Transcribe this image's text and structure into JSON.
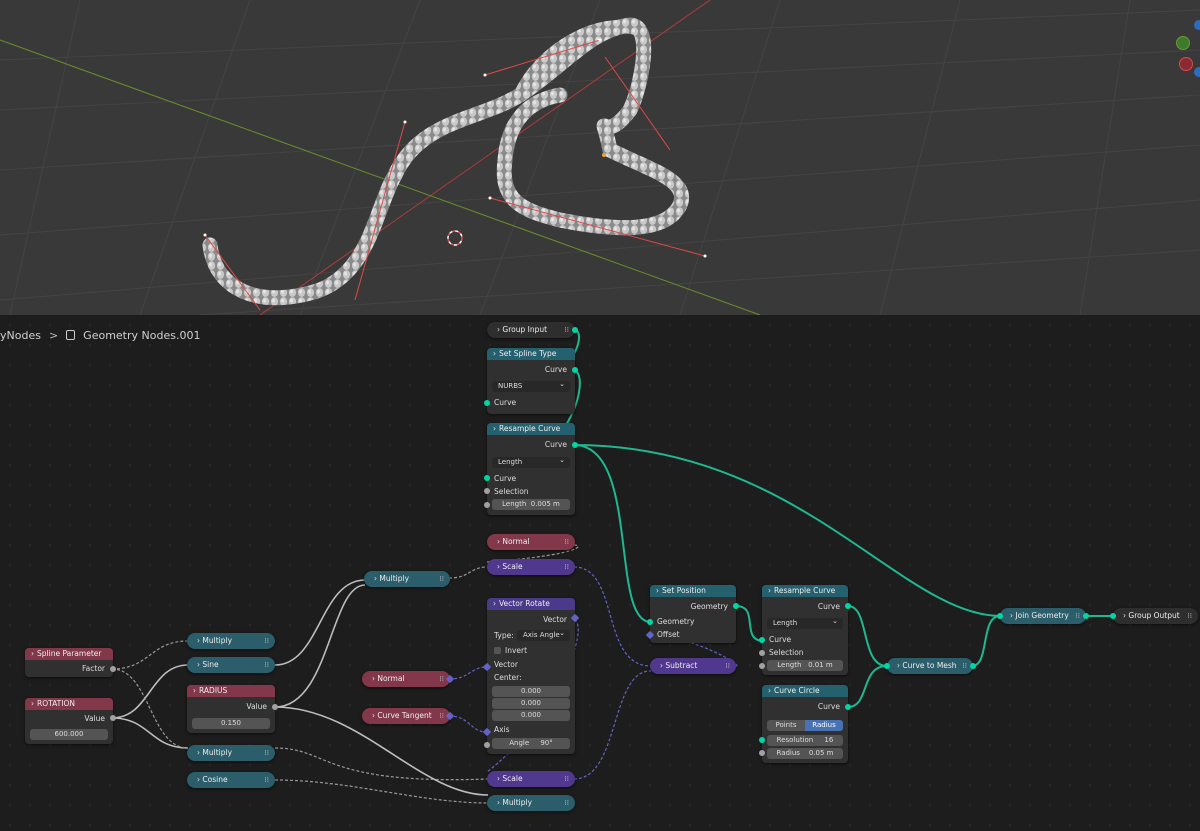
{
  "breadcrumb": {
    "root": "yNodes",
    "separator": ">",
    "tree_name": "Geometry Nodes.001"
  },
  "colors": {
    "geometry_socket": "#00d6a3",
    "value_socket": "#a1a1a1",
    "vector_socket": "#6363c7",
    "input_header": "#82374b",
    "geometry_header": "#25606e",
    "vector_header": "#4a3a8c"
  },
  "nodes": {
    "group_input": {
      "label": "Group Input"
    },
    "set_spline_type": {
      "title": "Set Spline Type",
      "out_curve": "Curve",
      "mode": "NURBS",
      "in_curve": "Curve"
    },
    "resample_curve_1": {
      "title": "Resample Curve",
      "out_curve": "Curve",
      "mode": "Length",
      "in_curve": "Curve",
      "selection": "Selection",
      "length_label": "Length",
      "length_value": "0.005 m"
    },
    "normal_1": {
      "label": "Normal"
    },
    "scale_1": {
      "label": "Scale"
    },
    "multiply_top": {
      "label": "Multiply"
    },
    "vector_rotate": {
      "title": "Vector Rotate",
      "out_vector": "Vector",
      "type_label": "Type:",
      "type_value": "Axis Angle",
      "invert": "Invert",
      "vector": "Vector",
      "center": "Center:",
      "cx": "0.000",
      "cy": "0.000",
      "cz": "0.000",
      "axis": "Axis",
      "angle_label": "Angle",
      "angle_value": "90°"
    },
    "spline_parameter": {
      "title": "Spline Parameter",
      "factor": "Factor"
    },
    "rotation": {
      "title": "ROTATION",
      "value_label": "Value",
      "value": "600.000"
    },
    "radius": {
      "title": "RADIUS",
      "value_label": "Value",
      "value": "0.150"
    },
    "multiply_a": {
      "label": "Multiply"
    },
    "sine": {
      "label": "Sine"
    },
    "multiply_b": {
      "label": "Multiply"
    },
    "cosine": {
      "label": "Cosine"
    },
    "normal_2": {
      "label": "Normal"
    },
    "curve_tangent": {
      "label": "Curve Tangent"
    },
    "scale_2": {
      "label": "Scale"
    },
    "multiply_bottom": {
      "label": "Multiply"
    },
    "set_position": {
      "title": "Set Position",
      "out_geometry": "Geometry",
      "in_geometry": "Geometry",
      "offset": "Offset"
    },
    "subtract": {
      "label": "Subtract"
    },
    "resample_curve_2": {
      "title": "Resample Curve",
      "out_curve": "Curve",
      "mode": "Length",
      "in_curve": "Curve",
      "selection": "Selection",
      "length_label": "Length",
      "length_value": "0.01 m"
    },
    "curve_circle": {
      "title": "Curve Circle",
      "out_curve": "Curve",
      "opt_points": "Points",
      "opt_radius": "Radius",
      "resolution_label": "Resolution",
      "resolution_value": "16",
      "radius_label": "Radius",
      "radius_value": "0.05 m"
    },
    "curve_to_mesh": {
      "label": "Curve to Mesh"
    },
    "join_geometry": {
      "label": "Join Geometry"
    },
    "group_output": {
      "label": "Group Output"
    }
  }
}
